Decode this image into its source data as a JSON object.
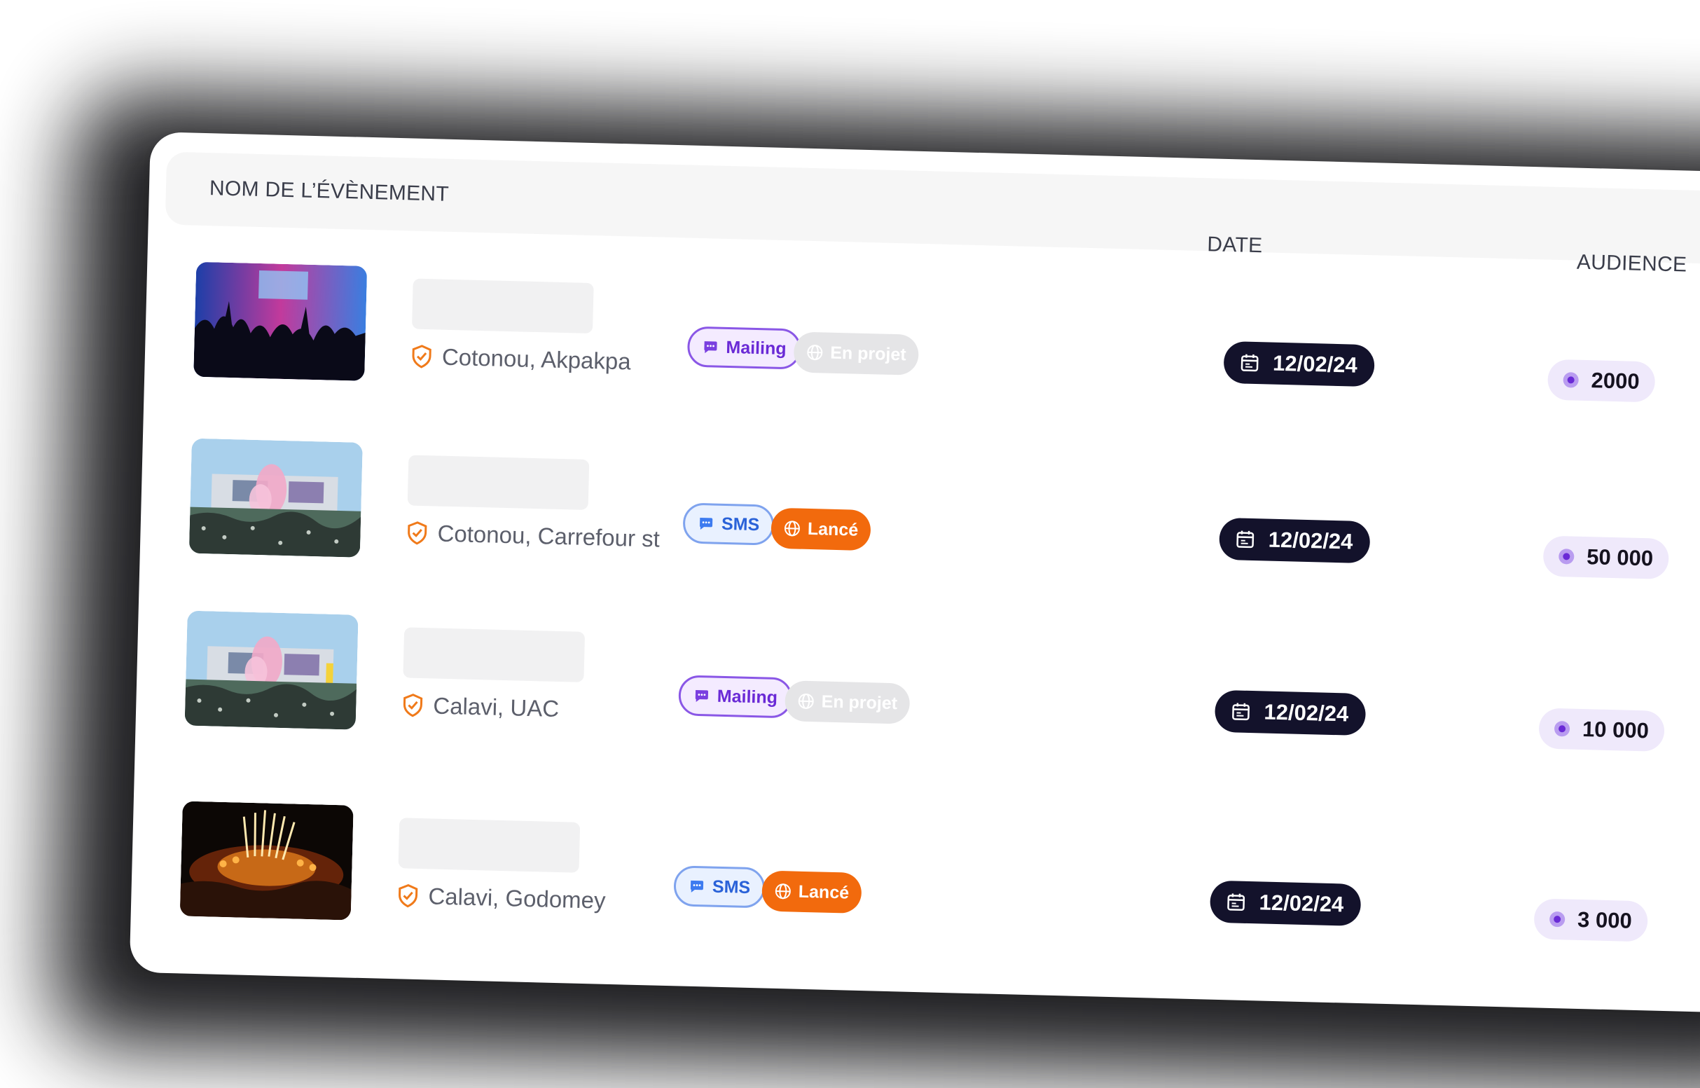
{
  "columns": {
    "name": "NOM DE L’ÉVÈNEMENT",
    "date": "DATE",
    "audience": "AUDIENCE"
  },
  "colors": {
    "accent_purple": "#6a2ad6",
    "accent_orange": "#f26a0d",
    "date_badge": "#13122b",
    "audience_badge": "#efe9fb"
  },
  "events": [
    {
      "image": "concert-crowd-stage-lights",
      "location": "Cotonou, Akpakpa",
      "channel": {
        "label": "Mailing",
        "icon": "chat-bubble-icon"
      },
      "status": {
        "label": "En projet",
        "icon": "globe-icon"
      },
      "date": "12/02/24",
      "audience": "2000"
    },
    {
      "image": "festival-crowd-pink-smoke",
      "location": "Cotonou, Carrefour st",
      "channel": {
        "label": "SMS",
        "icon": "chat-bubble-icon"
      },
      "status": {
        "label": "Lancé",
        "icon": "globe-icon"
      },
      "date": "12/02/24",
      "audience": "50 000"
    },
    {
      "image": "festival-crowd-pink-smoke",
      "location": "Calavi, UAC",
      "channel": {
        "label": "Mailing",
        "icon": "chat-bubble-icon"
      },
      "status": {
        "label": "En projet",
        "icon": "globe-icon"
      },
      "date": "12/02/24",
      "audience": "10 000"
    },
    {
      "image": "night-stage-fireworks",
      "location": "Calavi, Godomey",
      "channel": {
        "label": "SMS",
        "icon": "chat-bubble-icon"
      },
      "status": {
        "label": "Lancé",
        "icon": "globe-icon"
      },
      "date": "12/02/24",
      "audience": "3 000"
    }
  ]
}
